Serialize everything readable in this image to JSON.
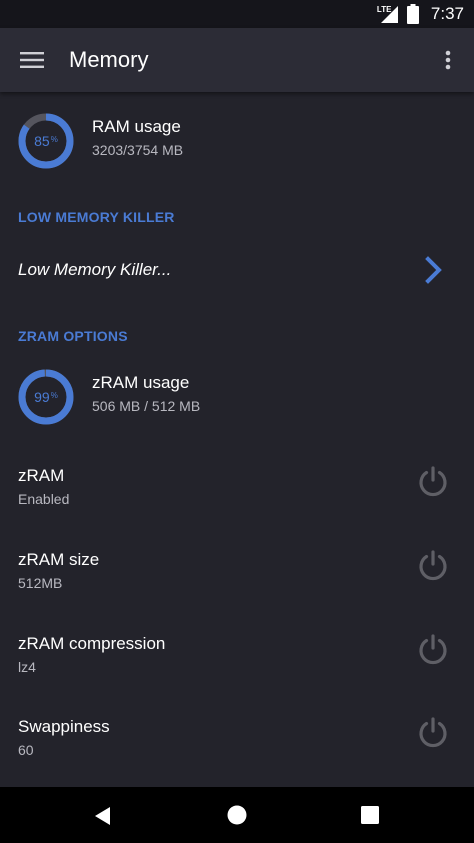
{
  "status_bar": {
    "network": "LTE",
    "time": "7:37"
  },
  "app_bar": {
    "title": "Memory"
  },
  "ram": {
    "percent_label": "85",
    "percent_sign": "%",
    "fraction": 0.85,
    "title": "RAM usage",
    "subtitle": "3203/3754 MB"
  },
  "sections": {
    "lmk": "LOW MEMORY KILLER",
    "zram": "ZRAM OPTIONS"
  },
  "lmk_item": {
    "label": "Low Memory Killer..."
  },
  "zram_usage": {
    "percent_label": "99",
    "percent_sign": "%",
    "fraction": 0.99,
    "title": "zRAM usage",
    "subtitle": "506 MB / 512 MB"
  },
  "options": [
    {
      "title": "zRAM",
      "value": "Enabled"
    },
    {
      "title": "zRAM size",
      "value": "512MB"
    },
    {
      "title": "zRAM compression",
      "value": "lz4"
    },
    {
      "title": "Swappiness",
      "value": "60"
    }
  ],
  "colors": {
    "accent": "#4a7bd4",
    "ring_track": "#55555e",
    "background": "#23232b",
    "app_bar": "#2c2c36"
  }
}
